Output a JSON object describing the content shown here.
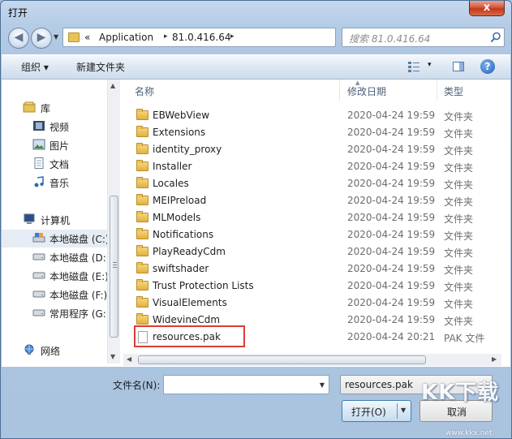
{
  "window": {
    "title": "打开",
    "close_label": "x"
  },
  "address": {
    "prefix": "«",
    "crumbs": [
      "Application",
      "81.0.416.64"
    ],
    "separator": "▸",
    "search_placeholder": "搜索 81.0.416.64"
  },
  "toolbar": {
    "organize": "组织 ▾",
    "new_folder": "新建文件夹",
    "view_drop": "▾",
    "help": "?"
  },
  "nav": {
    "items": [
      {
        "label": "库",
        "icon": "library-icon"
      },
      {
        "label": "视频",
        "icon": "video-icon"
      },
      {
        "label": "图片",
        "icon": "picture-icon"
      },
      {
        "label": "文档",
        "icon": "document-icon"
      },
      {
        "label": "音乐",
        "icon": "music-icon"
      },
      {
        "label": "计算机",
        "icon": "computer-icon"
      },
      {
        "label": "本地磁盘 (C:)",
        "icon": "drive-c-icon"
      },
      {
        "label": "本地磁盘 (D:)",
        "icon": "drive-icon"
      },
      {
        "label": "本地磁盘 (E:)",
        "icon": "drive-icon"
      },
      {
        "label": "本地磁盘 (F:)",
        "icon": "drive-icon"
      },
      {
        "label": "常用程序 (G:)",
        "icon": "drive-icon"
      },
      {
        "label": "网络",
        "icon": "network-icon"
      }
    ]
  },
  "columns": {
    "name": "名称",
    "date": "修改日期",
    "type": "类型"
  },
  "files": [
    {
      "name": "EBWebView",
      "date": "2020-04-24 19:59",
      "type": "文件夹",
      "kind": "folder"
    },
    {
      "name": "Extensions",
      "date": "2020-04-24 19:59",
      "type": "文件夹",
      "kind": "folder"
    },
    {
      "name": "identity_proxy",
      "date": "2020-04-24 19:59",
      "type": "文件夹",
      "kind": "folder"
    },
    {
      "name": "Installer",
      "date": "2020-04-24 19:59",
      "type": "文件夹",
      "kind": "folder"
    },
    {
      "name": "Locales",
      "date": "2020-04-24 19:59",
      "type": "文件夹",
      "kind": "folder"
    },
    {
      "name": "MEIPreload",
      "date": "2020-04-24 19:59",
      "type": "文件夹",
      "kind": "folder"
    },
    {
      "name": "MLModels",
      "date": "2020-04-24 19:59",
      "type": "文件夹",
      "kind": "folder"
    },
    {
      "name": "Notifications",
      "date": "2020-04-24 19:59",
      "type": "文件夹",
      "kind": "folder"
    },
    {
      "name": "PlayReadyCdm",
      "date": "2020-04-24 19:59",
      "type": "文件夹",
      "kind": "folder"
    },
    {
      "name": "swiftshader",
      "date": "2020-04-24 19:59",
      "type": "文件夹",
      "kind": "folder"
    },
    {
      "name": "Trust Protection Lists",
      "date": "2020-04-24 19:59",
      "type": "文件夹",
      "kind": "folder"
    },
    {
      "name": "VisualElements",
      "date": "2020-04-24 19:59",
      "type": "文件夹",
      "kind": "folder"
    },
    {
      "name": "WidevineCdm",
      "date": "2020-04-24 19:59",
      "type": "文件夹",
      "kind": "folder"
    },
    {
      "name": "resources.pak",
      "date": "2020-04-24 20:21",
      "type": "PAK 文件",
      "kind": "file"
    }
  ],
  "bottom": {
    "filename_label": "文件名(N):",
    "filename_value": "",
    "filetype_value": "resources.pak",
    "open_label": "打开(O)",
    "cancel_label": "取消"
  },
  "watermark": {
    "text": "KK下载",
    "url": "www.kkx.net"
  },
  "colors": {
    "highlight": "#dc3b35",
    "folder": "#e2b13c",
    "accent": "#3c7fb1"
  }
}
